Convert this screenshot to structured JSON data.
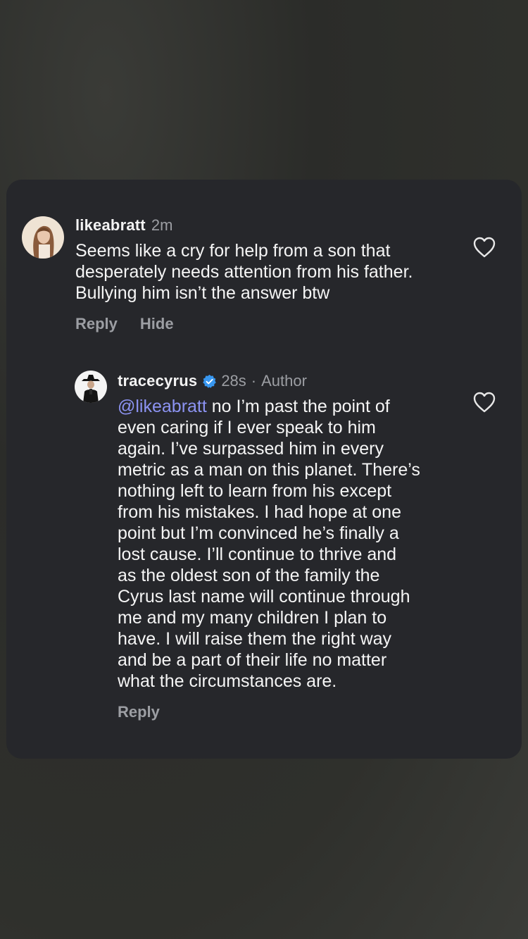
{
  "comments": [
    {
      "username": "likeabratt",
      "time": "2m",
      "lines": [
        "Seems like a cry for help from a son that",
        "desperately needs attention from his father.",
        "Bullying him isn’t the answer btw"
      ],
      "actions": {
        "reply": "Reply",
        "hide": "Hide"
      }
    },
    {
      "username": "tracecyrus",
      "time": "28s",
      "separator": "·",
      "author_label": "Author",
      "mention": "@likeabratt",
      "lines": [
        " no I’m past the point of",
        "even caring if I ever speak to him",
        "again. I’ve surpassed him in every",
        "metric as a man on this planet. There’s",
        "nothing left to learn from his except",
        "from his mistakes. I had hope at one",
        "point but I’m convinced he’s finally a",
        "lost cause. I’ll continue to thrive and",
        "as the oldest son of the family the",
        "Cyrus last name will continue through",
        "me and my many children I plan to",
        "have. I will raise them the right way",
        "and be a part of their life no matter",
        "what the circumstances are."
      ],
      "actions": {
        "reply": "Reply"
      }
    }
  ],
  "colors": {
    "card_background": "#26272b",
    "mention": "#8c93f2",
    "secondary_text": "#9c9ea3",
    "verified_badge": "#3897f0"
  },
  "icons": {
    "like": "heart-outline-icon",
    "verified": "verified-badge-icon"
  }
}
